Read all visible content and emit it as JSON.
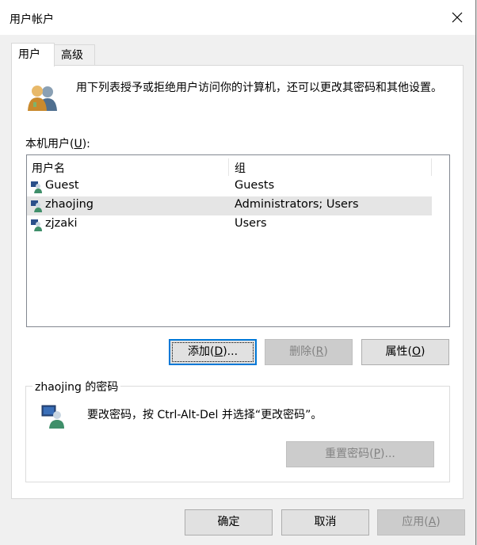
{
  "window": {
    "title": "用户帐户"
  },
  "tabs": [
    {
      "label": "用户",
      "active": true
    },
    {
      "label": "高级",
      "active": false
    }
  ],
  "intro": {
    "text": "用下列表授予或拒绝用户访问你的计算机，还可以更改其密码和其他设置。"
  },
  "users_section": {
    "label_prefix": "本机用户(",
    "label_key": "U",
    "label_suffix": "):"
  },
  "users_list": {
    "columns": [
      "用户名",
      "组"
    ],
    "rows": [
      {
        "name": "Guest",
        "group": "Guests",
        "selected": false
      },
      {
        "name": "zhaojing",
        "group": "Administrators; Users",
        "selected": true
      },
      {
        "name": "zjzaki",
        "group": "Users",
        "selected": false
      }
    ]
  },
  "user_buttons": {
    "add": {
      "prefix": "添加(",
      "key": "D",
      "suffix": ")..."
    },
    "remove": {
      "prefix": "删除(",
      "key": "R",
      "suffix": ")"
    },
    "properties": {
      "prefix": "属性(",
      "key": "O",
      "suffix": ")"
    }
  },
  "password_group": {
    "title": "zhaojing 的密码",
    "hint": "要改密码，按 Ctrl-Alt-Del 并选择“更改密码”。",
    "reset": {
      "prefix": "重置密码(",
      "key": "P",
      "suffix": ")..."
    }
  },
  "dialog_buttons": {
    "ok": "确定",
    "cancel": "取消",
    "apply": {
      "prefix": "应用(",
      "key": "A",
      "suffix": ")"
    }
  },
  "colors": {
    "accent": "#0078d7",
    "selection": "#e5e5e5",
    "disabled_text": "#838383"
  },
  "icons": [
    "close-icon",
    "users-icon",
    "user-icon",
    "user-password-icon"
  ]
}
